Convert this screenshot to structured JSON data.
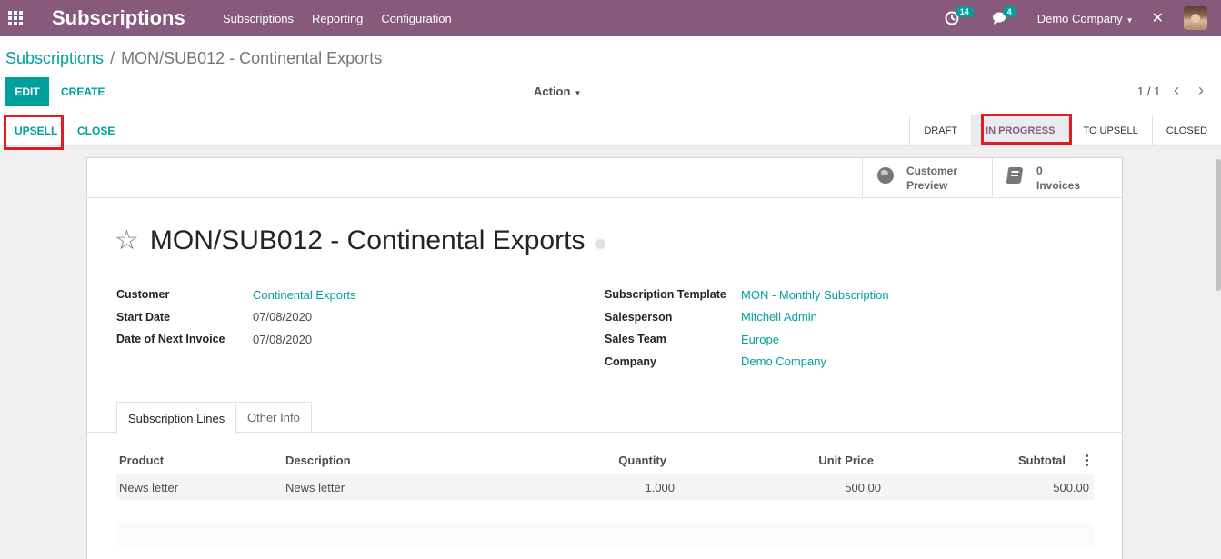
{
  "navbar": {
    "app_title": "Subscriptions",
    "menu": [
      "Subscriptions",
      "Reporting",
      "Configuration"
    ],
    "activity_count": "14",
    "message_count": "4",
    "company": "Demo Company"
  },
  "breadcrumb": {
    "parent": "Subscriptions",
    "separator": "/",
    "current": "MON/SUB012 - Continental Exports"
  },
  "control": {
    "edit_label": "EDIT",
    "create_label": "CREATE",
    "action_label": "Action",
    "pager": "1 / 1"
  },
  "statusbar": {
    "upsell_label": "UPSELL",
    "close_label": "CLOSE",
    "stages": [
      "Draft",
      "In Progress",
      "To Upsell",
      "Closed"
    ],
    "active_stage": "In Progress"
  },
  "smart_buttons": {
    "preview_line1": "Customer",
    "preview_line2": "Preview",
    "invoices_count": "0",
    "invoices_label": "Invoices"
  },
  "record": {
    "title": "MON/SUB012 - Continental Exports"
  },
  "fields_left": [
    {
      "label": "Customer",
      "value": "Continental Exports",
      "link": true
    },
    {
      "label": "Start Date",
      "value": "07/08/2020",
      "link": false
    },
    {
      "label": "Date of Next Invoice",
      "value": "07/08/2020",
      "link": false
    }
  ],
  "fields_right": [
    {
      "label": "Subscription Template",
      "value": "MON - Monthly Subscription",
      "link": true
    },
    {
      "label": "Salesperson",
      "value": "Mitchell Admin",
      "link": true
    },
    {
      "label": "Sales Team",
      "value": "Europe",
      "link": true
    },
    {
      "label": "Company",
      "value": "Demo Company",
      "link": true
    }
  ],
  "tabs": [
    "Subscription Lines",
    "Other Info"
  ],
  "lines": {
    "headers": {
      "product": "Product",
      "description": "Description",
      "quantity": "Quantity",
      "unit_price": "Unit Price",
      "subtotal": "Subtotal"
    },
    "rows": [
      {
        "product": "News letter",
        "description": "News letter",
        "quantity": "1.000",
        "unit_price": "500.00",
        "subtotal": "500.00"
      }
    ]
  },
  "colors": {
    "brand": "#875a7b",
    "accent": "#00a09d",
    "highlight": "#e11a24"
  }
}
